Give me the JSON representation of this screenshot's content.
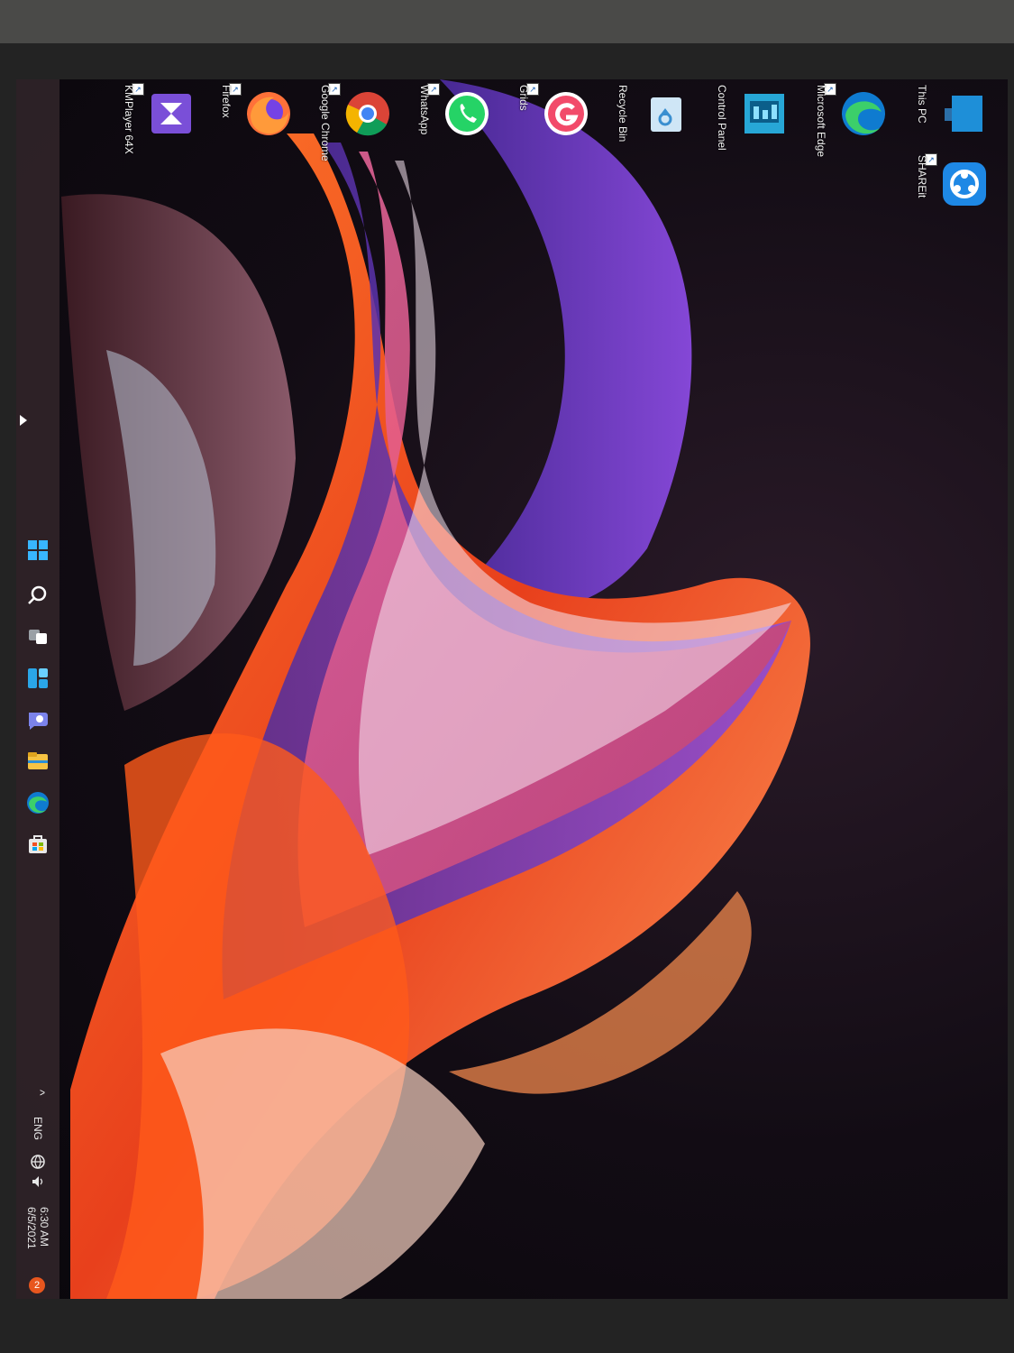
{
  "desktop": {
    "icons": [
      {
        "label": "This PC",
        "icon": "monitor-icon"
      },
      {
        "label": "SHAREit",
        "icon": "shareit-icon"
      },
      {
        "label": "Microsoft Edge",
        "icon": "edge-icon"
      },
      {
        "label": "Control Panel",
        "icon": "control-panel-icon"
      },
      {
        "label": "Recycle Bin",
        "icon": "recycle-bin-icon"
      },
      {
        "label": "Grids",
        "icon": "grids-icon"
      },
      {
        "label": "WhatsApp",
        "icon": "whatsapp-icon"
      },
      {
        "label": "Google Chrome",
        "icon": "chrome-icon"
      },
      {
        "label": "Firefox",
        "icon": "firefox-icon"
      },
      {
        "label": "KMPlayer 64X",
        "icon": "kmplayer-icon"
      }
    ]
  },
  "taskbar": {
    "pinned": [
      {
        "name": "start-button",
        "icon": "windows-icon"
      },
      {
        "name": "search-button",
        "icon": "search-icon"
      },
      {
        "name": "task-view-button",
        "icon": "task-view-icon"
      },
      {
        "name": "widgets-button",
        "icon": "widgets-icon"
      },
      {
        "name": "chat-button",
        "icon": "chat-icon"
      },
      {
        "name": "file-explorer-button",
        "icon": "folder-icon"
      },
      {
        "name": "edge-taskbar-button",
        "icon": "edge-icon"
      },
      {
        "name": "store-button",
        "icon": "store-icon"
      }
    ],
    "tray": {
      "chevron": "^",
      "language": "ENG",
      "time": "6:30 AM",
      "date": "6/5/2021",
      "notification_count": "2"
    }
  },
  "colors": {
    "accent_orange": "#e8561e",
    "accent_purple": "#7a3fd0",
    "wallpaper_dark": "#0c080e",
    "taskbar": "#30242a"
  }
}
